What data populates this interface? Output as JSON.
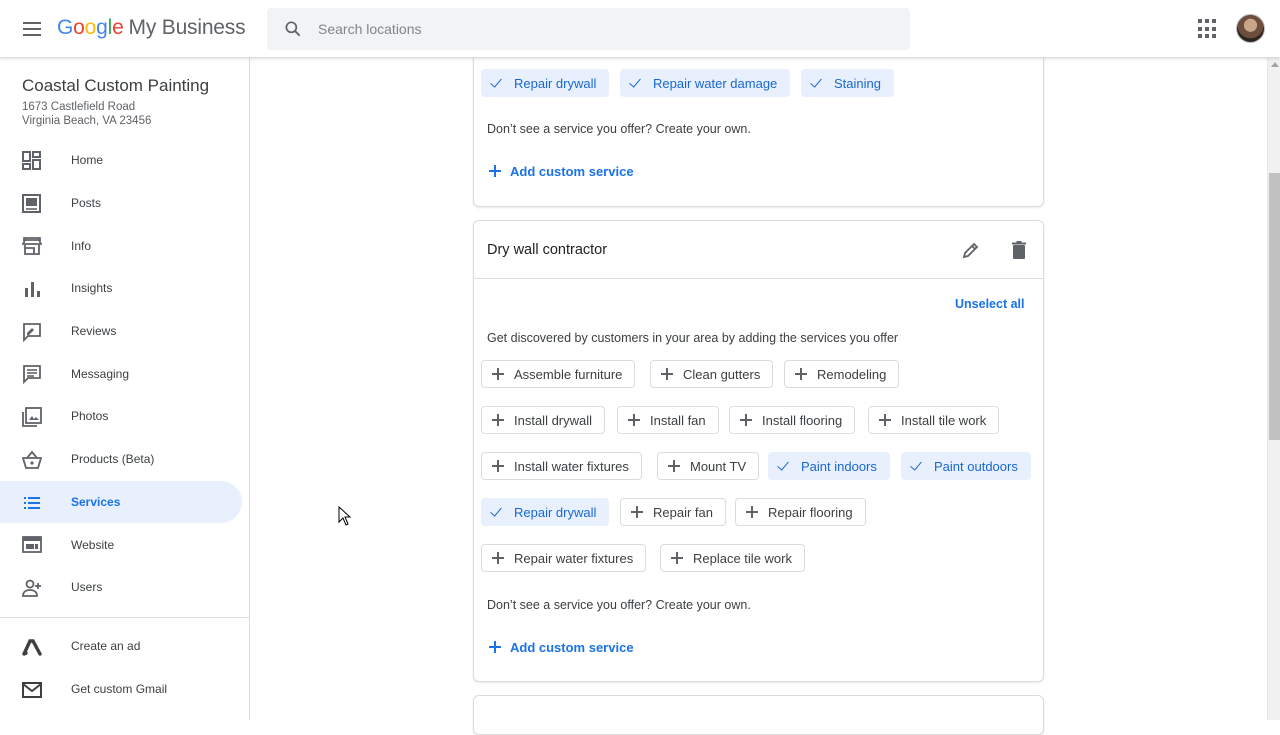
{
  "app": {
    "logo_google": [
      "G",
      "o",
      "o",
      "g",
      "l",
      "e"
    ],
    "logo_product": "My Business"
  },
  "search": {
    "placeholder": "Search locations"
  },
  "business": {
    "name": "Coastal Custom Painting",
    "address_line1": "1673 Castlefield Road",
    "address_line2": "Virginia Beach, VA 23456"
  },
  "sidebar": {
    "items": [
      {
        "label": "Home",
        "icon": "dashboard-icon"
      },
      {
        "label": "Posts",
        "icon": "posts-icon"
      },
      {
        "label": "Info",
        "icon": "storefront-icon"
      },
      {
        "label": "Insights",
        "icon": "bar-chart-icon"
      },
      {
        "label": "Reviews",
        "icon": "reviews-icon"
      },
      {
        "label": "Messaging",
        "icon": "message-icon"
      },
      {
        "label": "Photos",
        "icon": "photos-icon"
      },
      {
        "label": "Products (Beta)",
        "icon": "basket-icon"
      },
      {
        "label": "Services",
        "icon": "list-icon",
        "active": true
      },
      {
        "label": "Website",
        "icon": "website-icon"
      },
      {
        "label": "Users",
        "icon": "add-user-icon"
      }
    ],
    "extra": [
      {
        "label": "Create an ad",
        "icon": "ads-icon"
      },
      {
        "label": "Get custom Gmail",
        "icon": "gmail-icon"
      }
    ]
  },
  "top_card": {
    "chips": [
      {
        "label": "Repair drywall",
        "selected": true
      },
      {
        "label": "Repair water damage",
        "selected": true
      },
      {
        "label": "Staining",
        "selected": true
      }
    ],
    "prompt": "Don’t see a service you offer? Create your own.",
    "add_label": "Add custom service"
  },
  "category_card": {
    "title": "Dry wall contractor",
    "unselect_all": "Unselect all",
    "intro": "Get discovered by customers in your area by adding the services you offer",
    "chips": [
      {
        "label": "Assemble furniture",
        "selected": false
      },
      {
        "label": "Clean gutters",
        "selected": false
      },
      {
        "label": "Remodeling",
        "selected": false
      },
      {
        "label": "Install drywall",
        "selected": false
      },
      {
        "label": "Install fan",
        "selected": false
      },
      {
        "label": "Install flooring",
        "selected": false
      },
      {
        "label": "Install tile work",
        "selected": false
      },
      {
        "label": "Install water fixtures",
        "selected": false
      },
      {
        "label": "Mount TV",
        "selected": false
      },
      {
        "label": "Paint indoors",
        "selected": true
      },
      {
        "label": "Paint outdoors",
        "selected": true
      },
      {
        "label": "Repair drywall",
        "selected": true
      },
      {
        "label": "Repair fan",
        "selected": false
      },
      {
        "label": "Repair flooring",
        "selected": false
      },
      {
        "label": "Repair water fixtures",
        "selected": false
      },
      {
        "label": "Replace tile work",
        "selected": false
      }
    ],
    "prompt": "Don’t see a service you offer? Create your own.",
    "add_label": "Add custom service"
  },
  "colors": {
    "accent": "#1a73e8",
    "selected_chip_bg": "#e8f0fe",
    "selected_chip_text": "#1967d2"
  }
}
